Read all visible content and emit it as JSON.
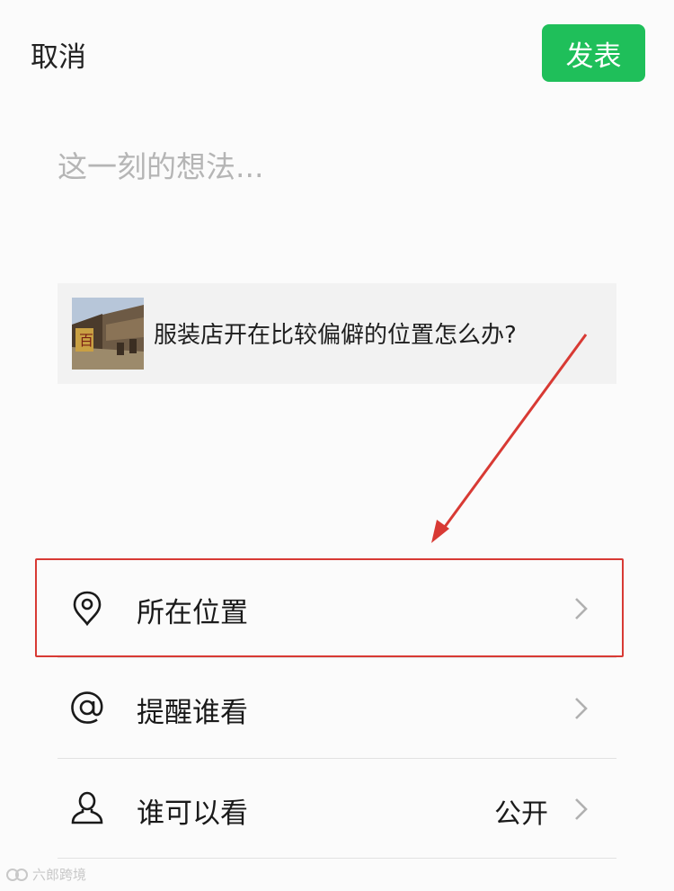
{
  "header": {
    "cancel_label": "取消",
    "publish_label": "发表",
    "publish_color": "#1fbf5a"
  },
  "composer": {
    "placeholder": "这一刻的想法..."
  },
  "shared_link": {
    "title": "服装店开在比较偏僻的位置怎么办?",
    "thumbnail_icon": "street-photo-thumbnail"
  },
  "options": [
    {
      "label": "所在位置",
      "icon": "location-pin-icon",
      "value": ""
    },
    {
      "label": "提醒谁看",
      "icon": "at-sign-icon",
      "value": ""
    },
    {
      "label": "谁可以看",
      "icon": "person-icon",
      "value": "公开"
    }
  ],
  "annotation": {
    "color": "#d83a34",
    "target": "所在位置"
  },
  "watermark": {
    "text": "六郎跨境"
  }
}
